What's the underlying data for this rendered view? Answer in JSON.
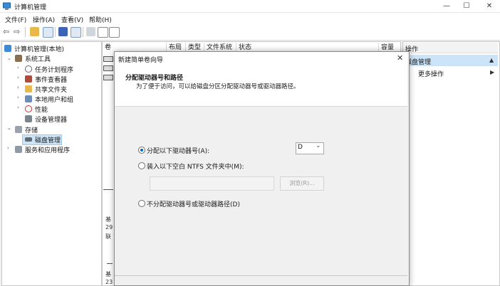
{
  "window": {
    "title": "计算机管理",
    "minimize_glyph": "—",
    "maximize_glyph": "☐",
    "close_glyph": "✕"
  },
  "menu": [
    "文件(F)",
    "操作(A)",
    "查看(V)",
    "帮助(H)"
  ],
  "tree": {
    "root": "计算机管理(本地)",
    "system_tools": "系统工具",
    "task_scheduler": "任务计划程序",
    "event_viewer": "事件查看器",
    "shared_folders": "共享文件夹",
    "local_users": "本地用户和组",
    "performance": "性能",
    "device_manager": "设备管理器",
    "storage": "存储",
    "disk_management": "磁盘管理",
    "services": "服务和应用程序"
  },
  "columns": {
    "volume": "卷",
    "layout": "布局",
    "type": "类型",
    "filesystem": "文件系统",
    "status": "状态",
    "capacity": "容量"
  },
  "disk_rows": {
    "row1": "基",
    "row2": "29",
    "row3": "联",
    "row4": "基",
    "row5": "23"
  },
  "actions": {
    "header": "操作",
    "disk_management": "磁盘管理",
    "more_actions": "更多操作"
  },
  "dialog": {
    "title": "新建简单卷向导",
    "heading": "分配驱动器号和路径",
    "subheading": "为了便于访问，可以给磁盘分区分配驱动器号或驱动器路径。",
    "option_assign": "分配以下驱动器号(A):",
    "drive_letter": "D",
    "option_mount": "装入以下空白 NTFS 文件夹中(M):",
    "browse": "浏览(R)...",
    "option_none": "不分配驱动器号或驱动器路径(D)",
    "close_glyph": "✕"
  },
  "colors": {
    "accent": "#0067c0",
    "selection": "#cce4f7"
  }
}
